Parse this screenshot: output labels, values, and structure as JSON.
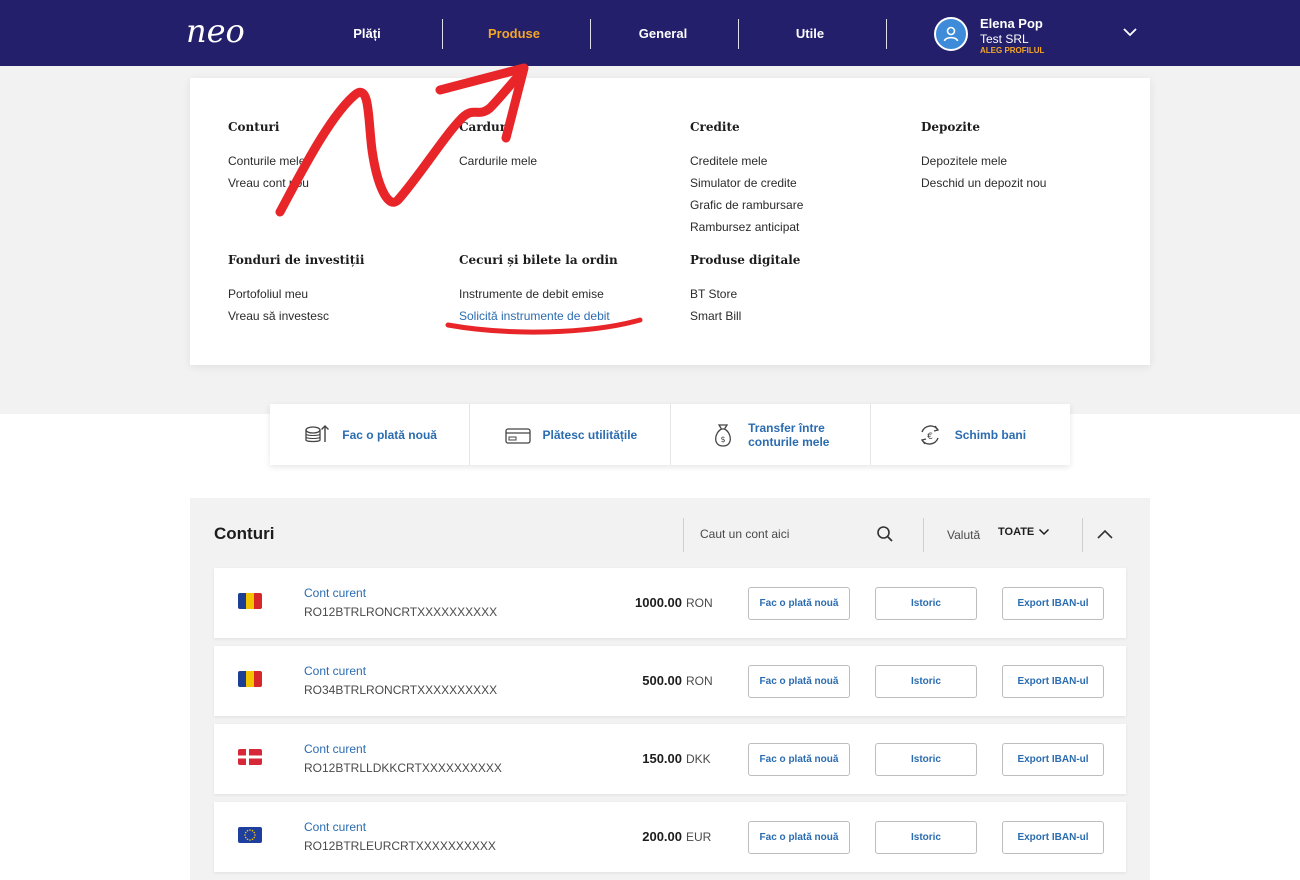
{
  "app": {
    "logo_text": "neo"
  },
  "nav": {
    "items": [
      {
        "label": "Plăți"
      },
      {
        "label": "Produse"
      },
      {
        "label": "General"
      },
      {
        "label": "Utile"
      }
    ],
    "active_color": "#f5a623",
    "bar_color": "#231f6b"
  },
  "profile": {
    "name": "Elena Pop",
    "company": "Test SRL",
    "switch_label": "ALEG PROFILUL"
  },
  "mega_menu": {
    "sections": [
      {
        "title": "Conturi",
        "links": [
          "Conturile mele",
          "Vreau cont nou"
        ]
      },
      {
        "title": "Carduri",
        "links": [
          "Cardurile mele"
        ]
      },
      {
        "title": "Credite",
        "links": [
          "Creditele mele",
          "Simulator de credite",
          "Grafic de rambursare",
          "Rambursez anticipat"
        ]
      },
      {
        "title": "Depozite",
        "links": [
          "Depozitele mele",
          "Deschid un depozit nou"
        ]
      },
      {
        "title": "Fonduri de investiții",
        "links": [
          "Portofoliul meu",
          "Vreau să investesc"
        ]
      },
      {
        "title": "Cecuri și bilete la ordin",
        "links": [
          "Instrumente de debit emise",
          "Solicită instrumente de debit"
        ]
      },
      {
        "title": "Produse digitale",
        "links": [
          "BT Store",
          "Smart Bill"
        ]
      }
    ],
    "highlighted_link": "Solicită instrumente de debit"
  },
  "quick_actions": [
    {
      "label": "Fac o plată nouă",
      "icon": "coins-icon"
    },
    {
      "label": "Plătesc utilitățile",
      "icon": "card-icon"
    },
    {
      "label": "Transfer între conturile mele",
      "icon": "money-bag-icon"
    },
    {
      "label": "Schimb bani",
      "icon": "exchange-icon"
    }
  ],
  "accounts": {
    "title": "Conturi",
    "search_placeholder": "Caut un cont aici",
    "currency_label": "Valută",
    "currency_value": "TOATE",
    "rows": [
      {
        "name": "Cont curent",
        "iban": "RO12BTRLRONCRTXXXXXXXXXX",
        "amount": "1000.00",
        "currency": "RON",
        "flag": "romania-flag-icon"
      },
      {
        "name": "Cont curent",
        "iban": "RO34BTRLRONCRTXXXXXXXXXX",
        "amount": "500.00",
        "currency": "RON",
        "flag": "romania-flag-icon"
      },
      {
        "name": "Cont curent",
        "iban": "RO12BTRLLDKKCRTXXXXXXXXXX",
        "amount": "150.00",
        "currency": "DKK",
        "flag": "denmark-flag-icon"
      },
      {
        "name": "Cont curent",
        "iban": "RO12BTRLEURCRTXXXXXXXXXX",
        "amount": "200.00",
        "currency": "EUR",
        "flag": "eu-flag-icon"
      }
    ],
    "row_actions": {
      "pay": "Fac o plată nouă",
      "history": "Istoric",
      "export": "Export IBAN-ul"
    }
  },
  "colors": {
    "link_blue": "#2b6cb0",
    "annotation_red": "#e8262a"
  }
}
